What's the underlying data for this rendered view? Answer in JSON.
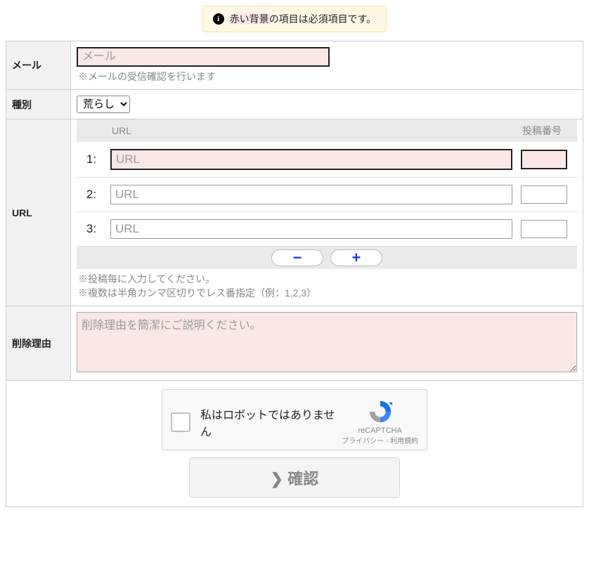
{
  "notice": {
    "text_pre": "赤い背景",
    "text_post": "の項目は必須項目です。"
  },
  "labels": {
    "mail": "メール",
    "kind": "種別",
    "url": "URL",
    "reason": "削除理由"
  },
  "mail": {
    "placeholder": "メール",
    "hint": "※メールの受信確認を行います"
  },
  "kind": {
    "selected": "荒らし"
  },
  "url_table": {
    "head_url": "URL",
    "head_postno": "投稿番号",
    "rows": [
      {
        "num": "1:",
        "placeholder": "URL",
        "required": true
      },
      {
        "num": "2:",
        "placeholder": "URL",
        "required": false
      },
      {
        "num": "3:",
        "placeholder": "URL",
        "required": false
      }
    ],
    "minus": "−",
    "plus": "+",
    "hint1": "※投稿毎に入力してください。",
    "hint2": "※複数は半角カンマ区切りでレス番指定（例：1,2,3）"
  },
  "reason": {
    "placeholder": "削除理由を簡潔にご説明ください。"
  },
  "captcha": {
    "text": "私はロボットではありません",
    "brand": "reCAPTCHA",
    "privacy": "プライバシー",
    "sep": " - ",
    "terms": "利用規約"
  },
  "confirm": "確認"
}
